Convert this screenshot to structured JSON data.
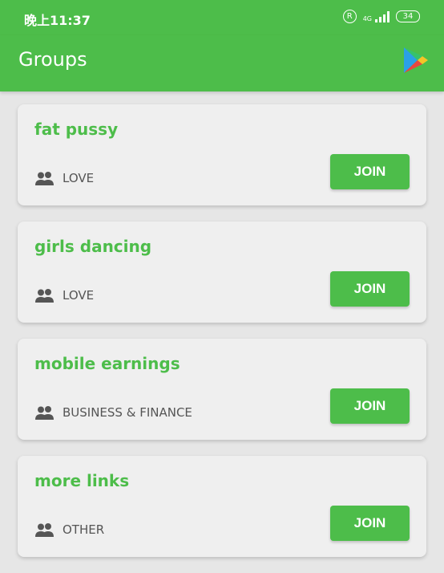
{
  "status": {
    "time": "晚上11:37",
    "reg": "R",
    "network": "4G",
    "battery": "34"
  },
  "appbar": {
    "title": "Groups"
  },
  "groups": [
    {
      "title": "fat pussy",
      "category": "LOVE",
      "button": "JOIN"
    },
    {
      "title": "girls dancing",
      "category": "LOVE",
      "button": "JOIN"
    },
    {
      "title": "mobile earnings",
      "category": "BUSINESS & FINANCE",
      "button": "JOIN"
    },
    {
      "title": "more links",
      "category": "OTHER",
      "button": "JOIN"
    }
  ],
  "colors": {
    "accent": "#4dbd4a",
    "background": "#e6e6e6",
    "card": "#efefef",
    "text": "#555555"
  },
  "icons": {
    "group": "people-icon",
    "store": "google-play-icon"
  }
}
